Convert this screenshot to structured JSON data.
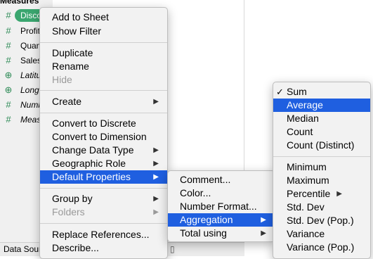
{
  "data_pane": {
    "section_title": "Measures",
    "fields": [
      {
        "name": "Discount",
        "icon": "#",
        "selected": true
      },
      {
        "name": "Profit",
        "icon": "#"
      },
      {
        "name": "Quantity",
        "icon": "#"
      },
      {
        "name": "Sales",
        "icon": "#"
      },
      {
        "name": "Latitude (generated)",
        "icon": "⊕",
        "italic": true
      },
      {
        "name": "Longitude (generated)",
        "icon": "⊕",
        "italic": true
      },
      {
        "name": "Number of Records",
        "icon": "#",
        "italic": true
      },
      {
        "name": "Measure Values",
        "icon": "#",
        "italic": true
      }
    ],
    "selected_pill_label": "Discount"
  },
  "bottom_bar": {
    "data_source_tab": "Data Source",
    "sheet_icon": "▯"
  },
  "context_menu": {
    "add_to_sheet": "Add to Sheet",
    "show_filter": "Show Filter",
    "duplicate": "Duplicate",
    "rename": "Rename",
    "hide": "Hide",
    "create": "Create",
    "convert_to_discrete": "Convert to Discrete",
    "convert_to_dimension": "Convert to Dimension",
    "change_data_type": "Change Data Type",
    "geographic_role": "Geographic Role",
    "default_properties": "Default Properties",
    "group_by": "Group by",
    "folders": "Folders",
    "replace_references": "Replace References...",
    "describe": "Describe...",
    "submenu_arrow": "▶"
  },
  "default_properties_menu": {
    "comment": "Comment...",
    "color": "Color...",
    "number_format": "Number Format...",
    "aggregation": "Aggregation",
    "total_using": "Total using"
  },
  "aggregation_menu": {
    "checked_mark": "✓",
    "items": {
      "sum": "Sum",
      "average": "Average",
      "median": "Median",
      "count": "Count",
      "count_distinct": "Count (Distinct)",
      "minimum": "Minimum",
      "maximum": "Maximum",
      "percentile": "Percentile",
      "std_dev": "Std. Dev",
      "std_dev_pop": "Std. Dev (Pop.)",
      "variance": "Variance",
      "variance_pop": "Variance (Pop.)"
    },
    "checked": "Sum",
    "highlighted": "Average"
  },
  "colors": {
    "highlight": "#1f5fe0",
    "pill": "#3aa66f",
    "field_icon": "#2e8b57"
  }
}
